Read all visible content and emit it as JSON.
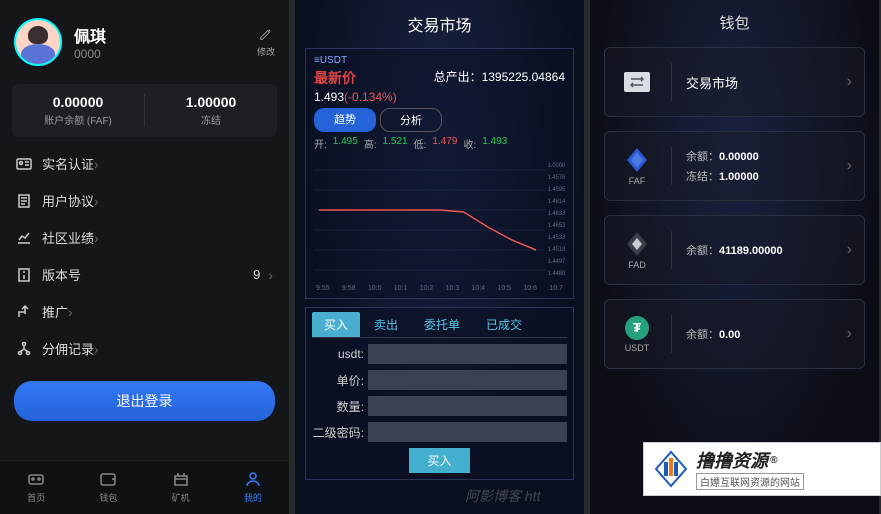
{
  "panel1": {
    "name": "佩琪",
    "user_id": "0000",
    "edit_label": "修改",
    "balance1_value": "0.00000",
    "balance1_label": "账户余额 (FAF)",
    "balance2_value": "1.00000",
    "balance2_label": "冻结",
    "menu": [
      {
        "label": "实名认证",
        "value": ""
      },
      {
        "label": "用户协议",
        "value": ""
      },
      {
        "label": "社区业绩",
        "value": ""
      },
      {
        "label": "版本号",
        "value": "9"
      },
      {
        "label": "推广",
        "value": ""
      },
      {
        "label": "分佣记录",
        "value": ""
      }
    ],
    "logout": "退出登录",
    "nav": [
      {
        "label": "首页"
      },
      {
        "label": "钱包"
      },
      {
        "label": "矿机"
      },
      {
        "label": "我的"
      }
    ]
  },
  "panel2": {
    "title": "交易市场",
    "pair": "≡USDT",
    "latest_label": "最新价",
    "total_out_label": "总产出：",
    "total_out_value": "1395225.04864",
    "price": "1.493",
    "change": "(-0.134%)",
    "trend_btn": "趋势",
    "analysis_btn": "分析",
    "ohlc": {
      "o_l": "开:",
      "o": "1.495",
      "h_l": "高:",
      "h": "1.521",
      "l_l": "低:",
      "l": "1.479",
      "c_l": "收:",
      "c": "1.493"
    },
    "ticks": [
      "9:55",
      "9:58",
      "10:0",
      "10:1",
      "10:2",
      "10:3",
      "10:4",
      "10:5",
      "10:6",
      "10:7"
    ],
    "ylabels": [
      "1.0000",
      "1.4576",
      "1.4595",
      "1.4614",
      "1.4633",
      "1.4653",
      "1.4533",
      "1.4518",
      "1.4497",
      "1.4480"
    ],
    "tabs": [
      "买入",
      "卖出",
      "委托单",
      "已成交"
    ],
    "form": {
      "usdt": "usdt:",
      "price": "单价:",
      "qty": "数量:",
      "pwd": "二级密码:"
    },
    "buy_btn": "买入",
    "watermark": "阿影博客 htt"
  },
  "panel3": {
    "title": "钱包",
    "market": {
      "label": "交易市场"
    },
    "faf": {
      "name": "FAF",
      "bal_l": "余额：",
      "bal_v": "0.00000",
      "frz_l": "冻结：",
      "frz_v": "1.00000"
    },
    "fad": {
      "name": "FAD",
      "bal_l": "余额：",
      "bal_v": "41189.00000"
    },
    "usdt": {
      "name": "USDT",
      "bal_l": "余额：",
      "bal_v": "0.00"
    }
  },
  "badge": {
    "title": "撸撸资源",
    "reg": "®",
    "sub": "白嫖互联网资源的网站"
  },
  "chart_data": {
    "type": "line",
    "pair": "USDT",
    "x": [
      "9:55",
      "9:58",
      "10:0",
      "10:1",
      "10:2",
      "10:3",
      "10:4",
      "10:5",
      "10:6",
      "10:7"
    ],
    "values": [
      1.517,
      1.517,
      1.517,
      1.517,
      1.517,
      1.517,
      1.515,
      1.505,
      1.498,
      1.493
    ],
    "ohlc": {
      "open": 1.495,
      "high": 1.521,
      "low": 1.479,
      "close": 1.493
    },
    "change_pct": -0.134,
    "ylim": [
      1.448,
      1.52
    ]
  }
}
